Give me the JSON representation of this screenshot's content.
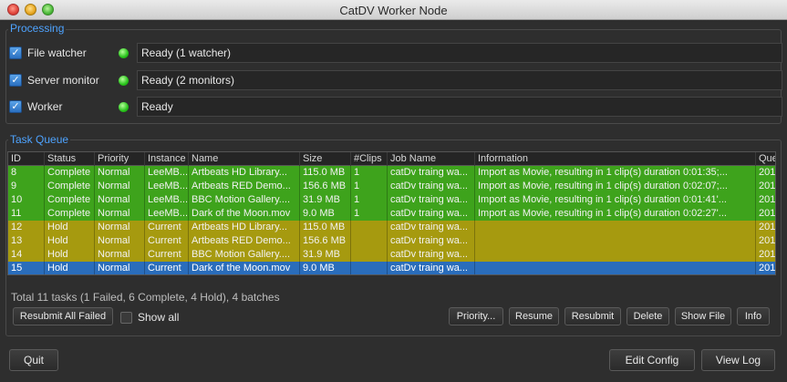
{
  "window": {
    "title": "CatDV Worker Node"
  },
  "processing": {
    "title": "Processing",
    "rows": [
      {
        "label": "File watcher",
        "checked": true,
        "status": "Ready (1 watcher)"
      },
      {
        "label": "Server monitor",
        "checked": true,
        "status": "Ready (2 monitors)"
      },
      {
        "label": "Worker",
        "checked": true,
        "status": "Ready"
      }
    ]
  },
  "task_queue": {
    "title": "Task Queue",
    "columns": [
      "ID",
      "Status",
      "Priority",
      "Instance",
      "Name",
      "Size",
      "#Clips",
      "Job Name",
      "Information",
      "Que"
    ],
    "rows": [
      {
        "state": "complete",
        "cells": [
          "8",
          "Complete",
          "Normal",
          "LeeMB...",
          "Artbeats HD Library...",
          "115.0 MB",
          "1",
          "catDv traing wa...",
          "Import as Movie, resulting in 1 clip(s) duration 0:01:35;...",
          "201"
        ]
      },
      {
        "state": "complete",
        "cells": [
          "9",
          "Complete",
          "Normal",
          "LeeMB...",
          "Artbeats RED Demo...",
          "156.6 MB",
          "1",
          "catDv traing wa...",
          "Import as Movie, resulting in 1 clip(s) duration 0:02:07;...",
          "201"
        ]
      },
      {
        "state": "complete",
        "cells": [
          "10",
          "Complete",
          "Normal",
          "LeeMB...",
          "BBC Motion Gallery....",
          "31.9 MB",
          "1",
          "catDv traing wa...",
          "Import as Movie, resulting in 1 clip(s) duration 0:01:41'...",
          "201"
        ]
      },
      {
        "state": "complete",
        "cells": [
          "11",
          "Complete",
          "Normal",
          "LeeMB...",
          "Dark of the Moon.mov",
          "9.0 MB",
          "1",
          "catDv traing wa...",
          "Import as Movie, resulting in 1 clip(s) duration 0:02:27'...",
          "201"
        ]
      },
      {
        "state": "hold",
        "cells": [
          "12",
          "Hold",
          "Normal",
          "Current",
          "Artbeats HD Library...",
          "115.0 MB",
          "",
          "catDv traing wa...",
          "",
          "201"
        ]
      },
      {
        "state": "hold",
        "cells": [
          "13",
          "Hold",
          "Normal",
          "Current",
          "Artbeats RED Demo...",
          "156.6 MB",
          "",
          "catDv traing wa...",
          "",
          "201"
        ]
      },
      {
        "state": "hold",
        "cells": [
          "14",
          "Hold",
          "Normal",
          "Current",
          "BBC Motion Gallery....",
          "31.9 MB",
          "",
          "catDv traing wa...",
          "",
          "201"
        ]
      },
      {
        "state": "selected",
        "cells": [
          "15",
          "Hold",
          "Normal",
          "Current",
          "Dark of the Moon.mov",
          "9.0 MB",
          "",
          "catDv traing wa...",
          "",
          "201"
        ]
      }
    ],
    "summary": "Total 11 tasks (1 Failed, 6 Complete, 4 Hold), 4 batches"
  },
  "buttons": {
    "resubmit_all_failed": "Resubmit All Failed",
    "show_all": "Show all",
    "priority": "Priority...",
    "resume": "Resume",
    "resubmit": "Resubmit",
    "delete": "Delete",
    "show_file": "Show File",
    "info": "Info",
    "quit": "Quit",
    "edit_config": "Edit Config",
    "view_log": "View Log"
  },
  "colors": {
    "accent_blue": "#4ea3ff",
    "complete_row": "#3ea31c",
    "hold_row": "#a69a0f",
    "selected_row": "#2a6dbb",
    "status_led": "#27c21a"
  }
}
